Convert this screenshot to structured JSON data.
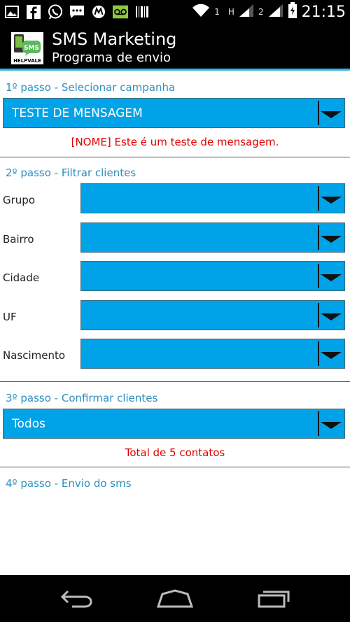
{
  "status_bar": {
    "time": "21:15",
    "signal_1": "1",
    "signal_2": "2",
    "signal_h": "H",
    "icons": [
      "image-icon",
      "facebook-icon",
      "whatsapp-icon",
      "sms-icon",
      "motorola-icon",
      "voicemail-icon",
      "barcode-icon",
      "wifi-icon",
      "signal-icon",
      "battery-icon"
    ]
  },
  "action_bar": {
    "title": "SMS Marketing",
    "subtitle": "Programa de envio",
    "logo_text_top": "SMS",
    "logo_text_bottom": "HELPVALE"
  },
  "step1": {
    "title": "1º passo - Selecionar campanha",
    "campaign_value": "TESTE DE MENSAGEM",
    "message_preview": "[NOME] Este é um teste de mensagem."
  },
  "step2": {
    "title": "2º passo - Filtrar clientes",
    "filters": [
      {
        "label": "Grupo",
        "value": ""
      },
      {
        "label": "Bairro",
        "value": ""
      },
      {
        "label": "Cidade",
        "value": ""
      },
      {
        "label": "UF",
        "value": ""
      },
      {
        "label": "Nascimento",
        "value": ""
      }
    ]
  },
  "step3": {
    "title": "3º passo - Confirmar clientes",
    "confirm_value": "Todos",
    "total_text": "Total de 5 contatos"
  },
  "step4": {
    "title": "4º passo - Envio do sms"
  },
  "colors": {
    "accent": "#33b5e5",
    "spinner": "#00a3e8",
    "section_title": "#2d8fc0",
    "alert_red": "#e00000"
  }
}
